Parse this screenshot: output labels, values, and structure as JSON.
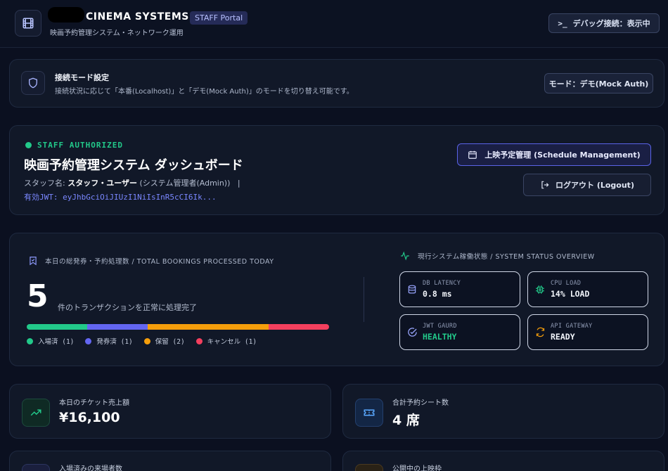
{
  "header": {
    "brand": "CINEMA SYSTEMS",
    "badge": "STAFF Portal",
    "subtitle": "映画予約管理システム・ネットワーク運用",
    "debug_button": "デバッグ接続：表示中",
    "debug_prompt": ">_"
  },
  "mode": {
    "title": "接続モード設定",
    "description": "接続状況に応じて「本番(Localhost)」と「デモ(Mock Auth)」のモードを切り替え可能です。",
    "button": "モード：デモ(Mock Auth)"
  },
  "auth": {
    "status": "STAFF AUTHORIZED",
    "title": "映画予約管理システム ダッシュボード",
    "staff_prefix": "スタッフ名:",
    "staff_name": "スタッフ・ユーザー",
    "staff_role": "(システム管理者(Admin))",
    "separator": "|",
    "jwt": "有効JWT: eyJhbGciOiJIUzI1NiIsInR5cCI6Ik...",
    "schedule_button": "上映予定管理 (Schedule Management)",
    "logout_button": "ログアウト (Logout)"
  },
  "bookings": {
    "title": "本日の総発券・予約処理数 / TOTAL BOOKINGS PROCESSED TODAY",
    "count": "5",
    "description": "件のトランザクションを正常に処理完了",
    "segments": [
      {
        "label": "入場済 (1)",
        "value": 1,
        "color": "#22c98a"
      },
      {
        "label": "発券済 (1)",
        "value": 1,
        "color": "#6366f1"
      },
      {
        "label": "保留 (2)",
        "value": 2,
        "color": "#f59e0b"
      },
      {
        "label": "キャンセル (1)",
        "value": 1,
        "color": "#f43f5e"
      }
    ]
  },
  "system": {
    "title": "現行システム稼働状態 / SYSTEM STATUS OVERVIEW",
    "items": [
      {
        "label": "DB LATENCY",
        "value": "0.8 ms"
      },
      {
        "label": "CPU LOAD",
        "value": "14% LOAD"
      },
      {
        "label": "JWT GAURD",
        "value": "HEALTHY"
      },
      {
        "label": "API GATEWAY",
        "value": "READY"
      }
    ]
  },
  "metrics": [
    {
      "label": "本日のチケット売上額",
      "value": "¥16,100"
    },
    {
      "label": "合計予約シート数",
      "value": "4 席"
    },
    {
      "label": "入場済みの来場者数",
      "value": ""
    },
    {
      "label": "公開中の上映枠",
      "value": ""
    }
  ],
  "colors": {
    "accent": "#6366f1",
    "success": "#22c98a",
    "warning": "#f59e0b",
    "danger": "#f43f5e"
  }
}
